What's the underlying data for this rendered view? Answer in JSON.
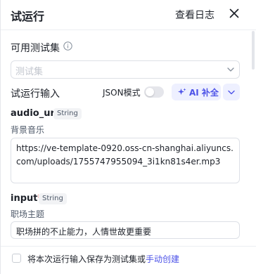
{
  "header": {
    "title": "试运行",
    "view_logs": "查看日志"
  },
  "testset": {
    "label": "可用测试集",
    "placeholder": "测试集"
  },
  "run_input": {
    "label": "试运行输入",
    "json_mode_label": "JSON模式",
    "json_mode_on": false,
    "ai_fill_label": "AI 补全"
  },
  "fields": [
    {
      "name": "audio_url",
      "required": "*",
      "type": "String",
      "description": "背景音乐",
      "value": "https://ve-template-0920.oss-cn-shanghai.aliyuncs.com/uploads/1755747955094_3i1kn81s4er.mp3"
    },
    {
      "name": "input",
      "required": "*",
      "type": "String",
      "description": "职场主题",
      "value": "职场拼的不止能力，人情世故更重要"
    }
  ],
  "footer": {
    "save_text": "将本次运行输入保存为测试集或",
    "manual_create": "手动创建"
  },
  "colors": {
    "accent": "#4d53e8",
    "accent_bg": "#eef0ff",
    "required": "#f53f3f"
  }
}
